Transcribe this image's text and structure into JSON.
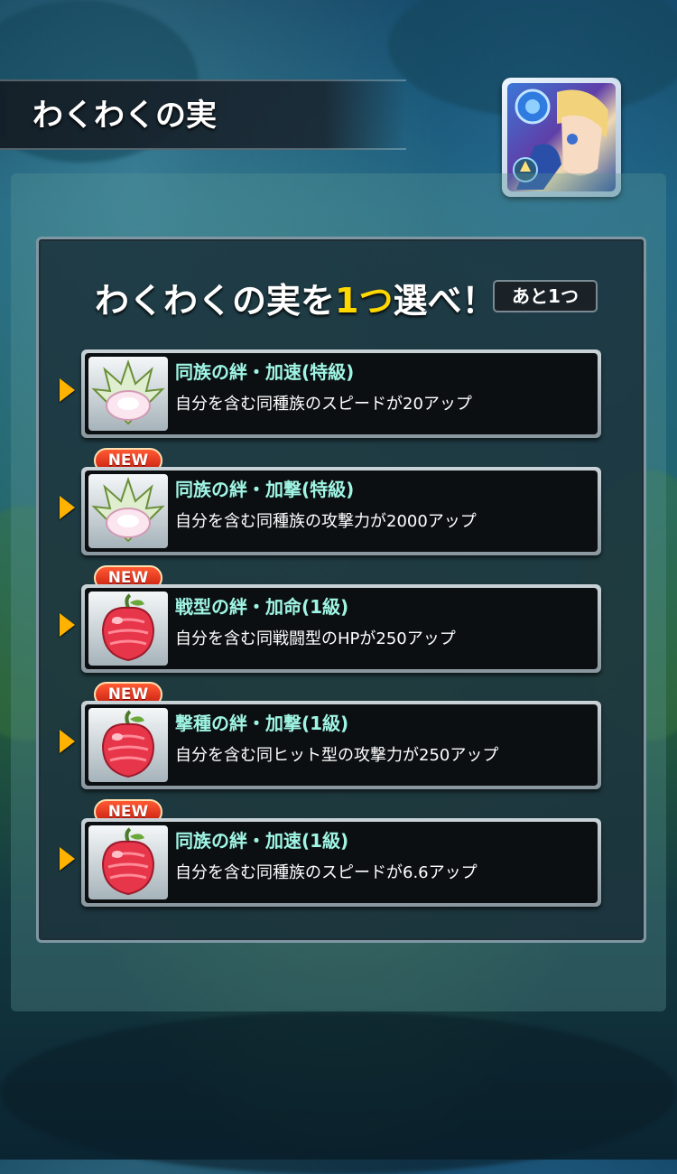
{
  "header": {
    "title": "わくわくの実"
  },
  "panel": {
    "heading_pre": "わくわくの実を",
    "heading_highlight": "1つ",
    "heading_post": "選べ！",
    "remaining": "あと1つ"
  },
  "options": [
    {
      "title": "同族の絆・加速(特級)",
      "desc": "自分を含む同種族のスピードが20アップ",
      "is_new": false,
      "icon": "white-fruit-icon"
    },
    {
      "title": "同族の絆・加撃(特級)",
      "desc": "自分を含む同種族の攻撃力が2000アップ",
      "is_new": true,
      "new_label": "NEW",
      "icon": "white-fruit-icon"
    },
    {
      "title": "戦型の絆・加命(1級)",
      "desc": "自分を含む同戦闘型のHPが250アップ",
      "is_new": true,
      "new_label": "NEW",
      "icon": "red-fruit-icon"
    },
    {
      "title": "撃種の絆・加撃(1級)",
      "desc": "自分を含む同ヒット型の攻撃力が250アップ",
      "is_new": true,
      "new_label": "NEW",
      "icon": "red-fruit-icon"
    },
    {
      "title": "同族の絆・加速(1級)",
      "desc": "自分を含む同種族のスピードが6.6アップ",
      "is_new": true,
      "new_label": "NEW",
      "icon": "red-fruit-icon"
    }
  ],
  "colors": {
    "accent": "#ffd800",
    "option_title": "#9ff5e4",
    "badge": "#e0321c",
    "arrow": "#ffb200"
  }
}
